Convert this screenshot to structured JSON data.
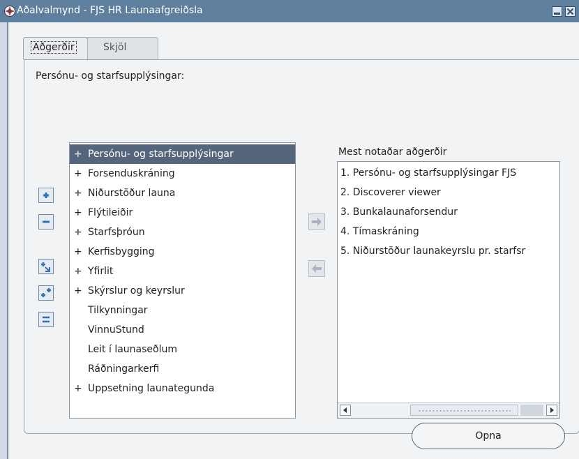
{
  "window": {
    "title": "Aðalvalmynd - FJS HR Launaafgreiðsla"
  },
  "tabs": [
    {
      "label": "Aðgerðir",
      "active": true
    },
    {
      "label": "Skjöl",
      "active": false
    }
  ],
  "main": {
    "section_label": "Persónu- og starfsupplýsingar:",
    "tree": [
      {
        "expander": "+",
        "label": "Persónu- og starfsupplýsingar",
        "selected": true
      },
      {
        "expander": "+",
        "label": "Forsenduskráning"
      },
      {
        "expander": "+",
        "label": "Niðurstöður launa"
      },
      {
        "expander": "+",
        "label": "Flýtileiðir"
      },
      {
        "expander": "+",
        "label": "Starfsþróun"
      },
      {
        "expander": "+",
        "label": "Kerfisbygging"
      },
      {
        "expander": "+",
        "label": "Yfirlit"
      },
      {
        "expander": "+",
        "label": "Skýrslur og keyrslur"
      },
      {
        "expander": "",
        "label": "Tilkynningar"
      },
      {
        "expander": "",
        "label": "VinnuStund"
      },
      {
        "expander": "",
        "label": "Leit í launaseðlum"
      },
      {
        "expander": "",
        "label": "Ráðningarkerfi"
      },
      {
        "expander": "+",
        "label": "Uppsetning launategunda"
      }
    ],
    "side_buttons": [
      "expand-icon",
      "collapse-icon",
      "expand-branch-icon",
      "expand-all-icon",
      "collapse-all-icon"
    ],
    "transfer_buttons": [
      "arrow-right-icon",
      "arrow-left-icon"
    ],
    "mru_label": "Mest notaðar aðgerðir",
    "mru": [
      "1. Persónu- og starfsupplýsingar FJS",
      "2. Discoverer viewer",
      "3. Bunkalaunaforsendur",
      "4. Tímaskráning",
      "5. Niðurstöður launakeyrslu pr. starfsr"
    ]
  },
  "footer": {
    "open_button": "Opna"
  },
  "colors": {
    "titlebar": "#5f7f9f",
    "selection": "#54657c",
    "background": "#f2f3f5"
  }
}
